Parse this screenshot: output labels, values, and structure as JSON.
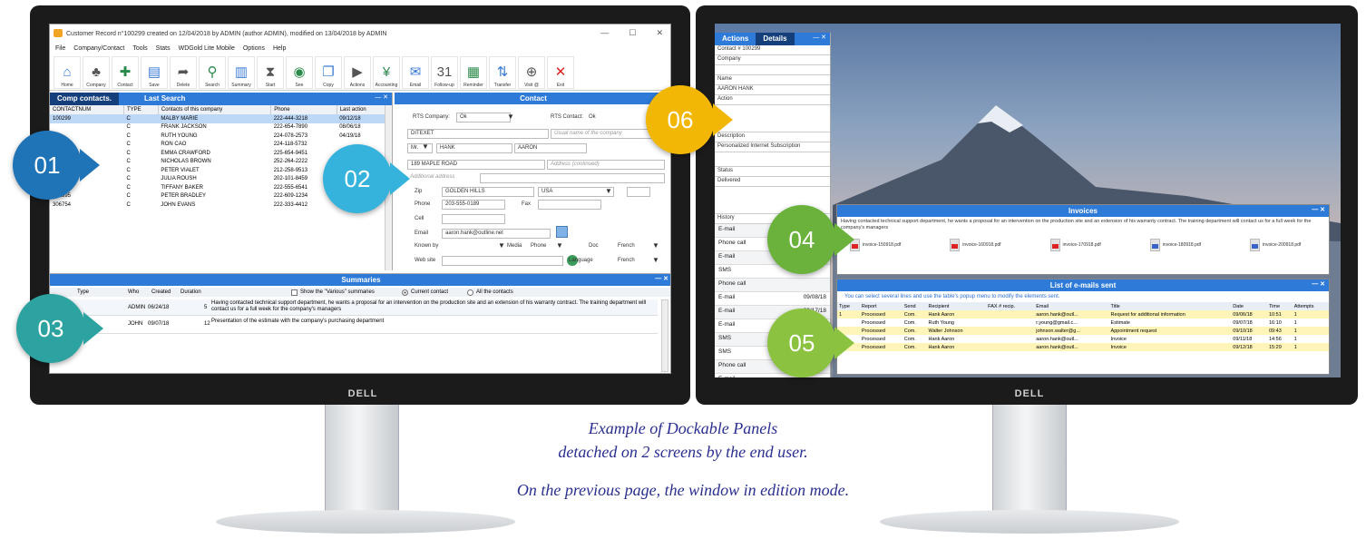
{
  "left_window": {
    "title": "Customer Record n°100299 created on 12/04/2018 by ADMIN (author ADMIN), modified on 13/04/2018 by ADMIN",
    "window_controls": [
      "—",
      "☐",
      "✕"
    ],
    "menu": [
      "File",
      "Company/Contact",
      "Tools",
      "Stats",
      "WDGold Lite Mobile",
      "Options",
      "Help"
    ],
    "toolbar": [
      {
        "label": "Home",
        "icon": "home-icon",
        "glyph": "⌂"
      },
      {
        "label": "Company",
        "icon": "company-icon",
        "glyph": "♣"
      },
      {
        "label": "Contact",
        "icon": "contact-add-icon",
        "glyph": "✚"
      },
      {
        "label": "Save",
        "icon": "save-icon",
        "glyph": "▤"
      },
      {
        "label": "Delete",
        "icon": "delete-icon",
        "glyph": "➦"
      },
      {
        "label": "Search",
        "icon": "search-icon",
        "glyph": "⚲"
      },
      {
        "label": "Summary",
        "icon": "summary-icon",
        "glyph": "▥"
      },
      {
        "label": "Start",
        "icon": "start-icon",
        "glyph": "⧗"
      },
      {
        "label": "See",
        "icon": "see-icon",
        "glyph": "◉"
      },
      {
        "label": "Copy",
        "icon": "copy-icon",
        "glyph": "❐"
      },
      {
        "label": "Actions",
        "icon": "actions-icon",
        "glyph": "▶"
      },
      {
        "label": "Accounting",
        "icon": "accounting-icon",
        "glyph": "¥"
      },
      {
        "label": "Email",
        "icon": "email-icon",
        "glyph": "✉"
      },
      {
        "label": "Follow-up",
        "icon": "followup-icon",
        "glyph": "31"
      },
      {
        "label": "Reminder",
        "icon": "reminder-icon",
        "glyph": "▦"
      },
      {
        "label": "Transfer",
        "icon": "transfer-icon",
        "glyph": "⇅"
      },
      {
        "label": "Visit @",
        "icon": "web-icon",
        "glyph": "⊕"
      },
      {
        "label": "Exit",
        "icon": "exit-icon",
        "glyph": "✕"
      }
    ],
    "contacts_panel": {
      "tabs": [
        "Comp contacts.",
        "Last Search"
      ],
      "columns": [
        "CONTACTNUM",
        "TYPE",
        "Contacts of this company",
        "Phone",
        "Last action"
      ],
      "rows": [
        [
          "100299",
          "C",
          "MALBY MARIE",
          "222-444-3218",
          "09/12/18"
        ],
        [
          "",
          "C",
          "FRANK JACKSON",
          "222-654-7890",
          "08/06/18"
        ],
        [
          "",
          "C",
          "RUTH YOUNG",
          "224-078-2573",
          "04/19/18"
        ],
        [
          "",
          "C",
          "RON CAO",
          "224-118-5732",
          ""
        ],
        [
          "",
          "C",
          "EMMA CRAWFORD",
          "225-654-9451",
          ""
        ],
        [
          "",
          "C",
          "NICHOLAS BROWN",
          "252-264-2222",
          ""
        ],
        [
          "",
          "C",
          "PETER VIALET",
          "212-258-9513",
          ""
        ],
        [
          "",
          "C",
          "JULIA ROUSH",
          "202-101-8459",
          ""
        ],
        [
          "",
          "C",
          "TIFFANY BAKER",
          "222-555-6541",
          ""
        ],
        [
          "301895",
          "C",
          "PETER BRADLEY",
          "222-609-1234",
          ""
        ],
        [
          "306754",
          "C",
          "JOHN EVANS",
          "222-333-4412",
          "09/26/18"
        ]
      ]
    },
    "contact_panel": {
      "title": "Contact",
      "rts_company_label": "RTS Company:",
      "rts_company_value": "Ok",
      "rts_contact_label": "RTS Contact:",
      "rts_contact_value": "Ok",
      "company": "DITEXET",
      "usual_name_placeholder": "Usual name of the company",
      "title_value": "Mr.",
      "last_name": "HANK",
      "first_name": "AARON",
      "address": "189 MAPLE ROAD",
      "address_cont_placeholder": "Address (continued)",
      "additional_address": "Additional address",
      "zip_label": "Zip",
      "city": "GOLDEN HILLS",
      "country": "USA",
      "phone_label": "Phone",
      "phone": "203-555-0189",
      "fax_label": "Fax",
      "cell_label": "Cell",
      "email_label": "Email",
      "email": "aaron.hank@outline.net",
      "known_by_label": "Known by",
      "media_label": "Media",
      "media_value": "Phone",
      "doc_label": "Doc",
      "doc_value": "French",
      "language_label": "Language",
      "language_value": "French",
      "website_label": "Web site"
    },
    "summaries_panel": {
      "title": "Summaries",
      "columns": [
        "Type",
        "Who",
        "Created",
        "Duration"
      ],
      "show_various_label": "Show the \"Various\" summaries",
      "current_contact_label": "Current contact",
      "all_contacts_label": "All the contacts",
      "rows": [
        {
          "who": "ADMIN",
          "created": "06/24/18",
          "duration": "5",
          "text": "Having contacted technical support department, he wants a proposal for an intervention on the production site and an extension of his warranty contract. The training department will contact us for a full week for the company's managers"
        },
        {
          "who": "JOHN",
          "created": "09/07/18",
          "duration": "12",
          "text": "Presentation of the estimate with the company's purchasing department"
        }
      ]
    }
  },
  "right_window": {
    "side_tabs": [
      "Actions",
      "Details"
    ],
    "details": {
      "contact_num_label": "Contact #",
      "contact_num": "100299",
      "company_label": "Company",
      "name_label": "Name",
      "name_value": "AARON HANK",
      "action_label": "Action",
      "description_label": "Description",
      "description_value": "Personalized Internet Subscription",
      "status_label": "Status",
      "status_value": "Delivered",
      "history_label": "History"
    },
    "history": [
      {
        "type": "E-mail",
        "date": ""
      },
      {
        "type": "Phone call",
        "date": ""
      },
      {
        "type": "E-mail",
        "date": ""
      },
      {
        "type": "SMS",
        "date": ""
      },
      {
        "type": "Phone call",
        "date": ""
      },
      {
        "type": "E-mail",
        "date": "09/08/18"
      },
      {
        "type": "E-mail",
        "date": "09/17/18"
      },
      {
        "type": "E-mail",
        "date": ""
      },
      {
        "type": "SMS",
        "date": ""
      },
      {
        "type": "SMS",
        "date": ""
      },
      {
        "type": "Phone call",
        "date": ""
      },
      {
        "type": "E-mail",
        "date": ""
      },
      {
        "type": "SMS",
        "date": ""
      }
    ],
    "invoices_panel": {
      "title": "Invoices",
      "note": "Having contacted technical support department, he wants a proposal for an intervention on the production site and an extension of his warranty contract. The training department will contact us for a full week for the company's managers",
      "files": [
        {
          "name": "invoice-150918.pdf",
          "kind": "pdf"
        },
        {
          "name": "invoice-160918.pdf",
          "kind": "pdf"
        },
        {
          "name": "invoice-170918.pdf",
          "kind": "pdf"
        },
        {
          "name": "invoice-180918.pdf",
          "kind": "doc"
        },
        {
          "name": "invoice-200918.pdf",
          "kind": "doc"
        }
      ]
    },
    "emails_panel": {
      "title": "List of e-mails sent",
      "hint": "You can select several lines and use the table's popup menu to modify the elements sent.",
      "columns": [
        "Type",
        "Report",
        "Send",
        "Recipient",
        "FAX # recip.",
        "Email",
        "Title",
        "Date",
        "Time",
        "Attempts"
      ],
      "rows": [
        [
          "1",
          "Processed",
          "Com.",
          "Hank Aaron",
          "aaron.hank@outl...",
          "Request for additional information",
          "09/06/18",
          "10:51",
          "1"
        ],
        [
          "",
          "Processed",
          "Com.",
          "Ruth Young",
          "r.young@gmail.c...",
          "Estimate",
          "09/07/18",
          "16:10",
          "1"
        ],
        [
          "",
          "Processed",
          "Com.",
          "Walter Johnson",
          "johnson.walter@g...",
          "Appointment request",
          "09/10/18",
          "09:43",
          "1"
        ],
        [
          "",
          "Processed",
          "Com.",
          "Hank Aaron",
          "aaron.hank@outl...",
          "Invoice",
          "09/11/18",
          "14:56",
          "1"
        ],
        [
          "",
          "Processed",
          "Com.",
          "Hank Aaron",
          "aaron.hank@outl...",
          "Invoice",
          "09/12/18",
          "15:29",
          "1"
        ]
      ]
    }
  },
  "bubbles": [
    {
      "label": "01",
      "color": "#1f74b8"
    },
    {
      "label": "02",
      "color": "#35b3dc"
    },
    {
      "label": "03",
      "color": "#2ca3a0"
    },
    {
      "label": "04",
      "color": "#6ab23b"
    },
    {
      "label": "05",
      "color": "#8bc23f"
    },
    {
      "label": "06",
      "color": "#f2b705"
    }
  ],
  "monitor_brand": "DELL",
  "caption": {
    "line1": "Example of Dockable Panels",
    "line2": "detached on 2 screens by the end user.",
    "line3": "On the previous page, the window in edition mode."
  }
}
